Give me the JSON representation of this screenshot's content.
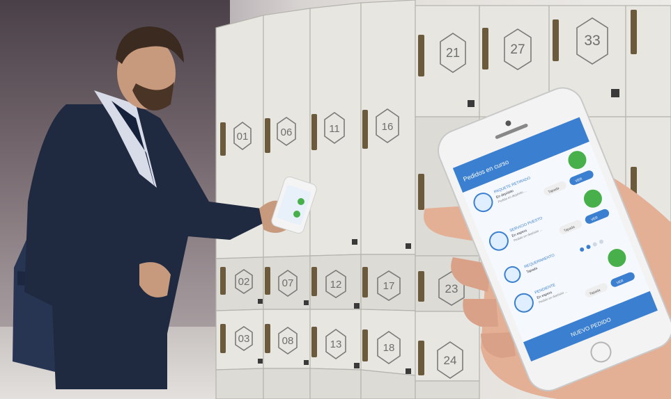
{
  "lockers": [
    {
      "number": "01"
    },
    {
      "number": "06"
    },
    {
      "number": "11"
    },
    {
      "number": "16"
    },
    {
      "number": "21"
    },
    {
      "number": "27"
    },
    {
      "number": "33"
    },
    {
      "number": "02"
    },
    {
      "number": "07"
    },
    {
      "number": "12"
    },
    {
      "number": "17"
    },
    {
      "number": "23"
    },
    {
      "number": "03"
    },
    {
      "number": "08"
    },
    {
      "number": "13"
    },
    {
      "number": "18"
    },
    {
      "number": "24"
    }
  ],
  "phone_app": {
    "header_title": "Pedidos en curso",
    "cards": [
      {
        "title": "PAQUETE RETIRADO",
        "status": "En depósito",
        "sub": "Pedido en depósito ...",
        "tag": "Tapada",
        "action": "VER"
      },
      {
        "title": "SERVICIO PUESTO",
        "status": "En espera",
        "sub": "Pedido en depósito ...",
        "tag": "Tapada",
        "action": "VER"
      },
      {
        "title": "REQUERIMIENTO",
        "status": "Tapada",
        "sub": "",
        "tag": "",
        "action": ""
      },
      {
        "title": "PENDIENTE",
        "status": "En espera",
        "sub": "Pedido en depósito ...",
        "tag": "Tapada",
        "action": "VER"
      }
    ],
    "footer_button": "NUEVO PEDIDO"
  },
  "colors": {
    "app_blue": "#3b7fd0",
    "badge_green": "#48b04a",
    "locker_face": "#e7e6e1"
  }
}
